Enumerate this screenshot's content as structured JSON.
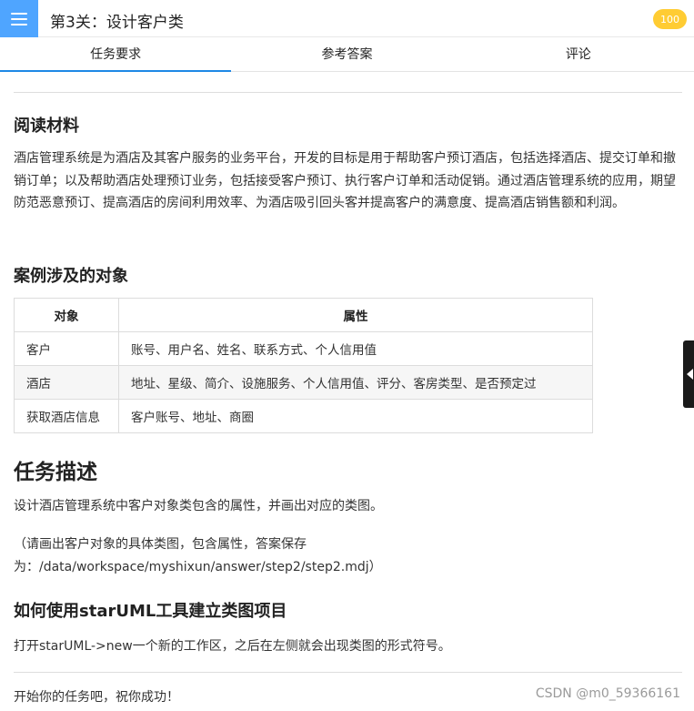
{
  "header": {
    "title": "第3关：设计客户类",
    "score": "100"
  },
  "tabs": [
    {
      "label": "任务要求"
    },
    {
      "label": "参考答案"
    },
    {
      "label": "评论"
    }
  ],
  "content": {
    "reading_heading": "阅读材料",
    "reading_text": "酒店管理系统是为酒店及其客户服务的业务平台，开发的目标是用于帮助客户预订酒店，包括选择酒店、提交订单和撤销订单；以及帮助酒店处理预订业务，包括接受客户预订、执行客户订单和活动促销。通过酒店管理系统的应用，期望防范恶意预订、提高酒店的房间利用效率、为酒店吸引回头客并提高客户的满意度、提高酒店销售额和利润。",
    "objects_heading": "案例涉及的对象",
    "table": {
      "headers": [
        "对象",
        "属性"
      ],
      "rows": [
        [
          "客户",
          "账号、用户名、姓名、联系方式、个人信用值"
        ],
        [
          "酒店",
          "地址、星级、简介、设施服务、个人信用值、评分、客房类型、是否预定过"
        ],
        [
          "获取酒店信息",
          "客户账号、地址、商圈"
        ]
      ]
    },
    "task_heading": "任务描述",
    "task_text": "设计酒店管理系统中客户对象类包含的属性，并画出对应的类图。",
    "task_note_line1": "（请画出客户对象的具体类图，包含属性，答案保存",
    "task_note_line2": "为：/data/workspace/myshixun/answer/step2/step2.mdj）",
    "howto_heading": "如何使用starUML工具建立类图项目",
    "howto_text": "打开starUML->new一个新的工作区，之后在左侧就会出现类图的形式符号。",
    "closing_text": "开始你的任务吧，祝你成功！"
  },
  "watermark": "CSDN @m0_59366161",
  "colors": {
    "menu_button": "#4fa5ff",
    "score_badge": "#ffcc33",
    "active_tab_underline": "#1e88e5"
  },
  "icons": {
    "menu": "hamburger-menu-icon",
    "side_toggle": "triangle-left-icon"
  }
}
